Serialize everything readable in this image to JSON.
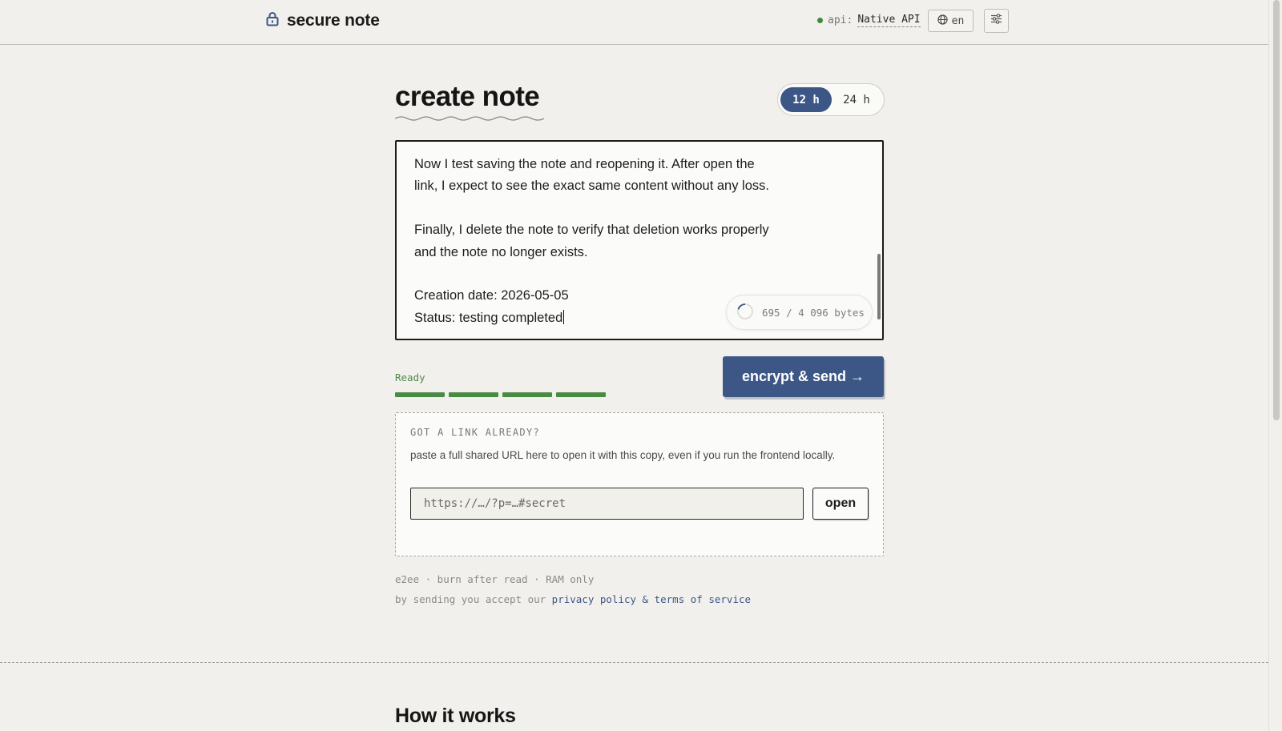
{
  "header": {
    "brand": "secure note",
    "api_label": "api:",
    "api_value": "Native API",
    "lang": "en"
  },
  "main": {
    "title": "create note",
    "ttl_options": [
      "12 h",
      "24 h"
    ],
    "ttl_selected": "12 h",
    "editor_lines": [
      "Now I test saving the note and reopening it. After open the",
      "link, I expect to see the exact same content without any loss.",
      "",
      "Finally, I delete the note to verify that deletion works properly",
      "and the note no longer exists.",
      "",
      "Creation date: 2026-05-05",
      "Status: testing completed"
    ],
    "byte_counter": "695 / 4 096 bytes",
    "status": "Ready",
    "strength_segments_filled": 4,
    "send_button": "encrypt & send →"
  },
  "link_box": {
    "heading": "GOT A LINK ALREADY?",
    "description": "paste a full shared URL here to open it with this copy, even if you run the frontend locally.",
    "placeholder": "https://…/?p=…#secret",
    "open_button": "open"
  },
  "footer": {
    "tagline": "e2ee · burn after read · RAM only",
    "terms_prefix": "by sending you accept our ",
    "terms_link": "privacy policy & terms of service"
  },
  "section": {
    "how_title": "How it works"
  },
  "colors": {
    "accent": "#3c5786",
    "success": "#4a8a44",
    "background": "#f1f0ec"
  }
}
